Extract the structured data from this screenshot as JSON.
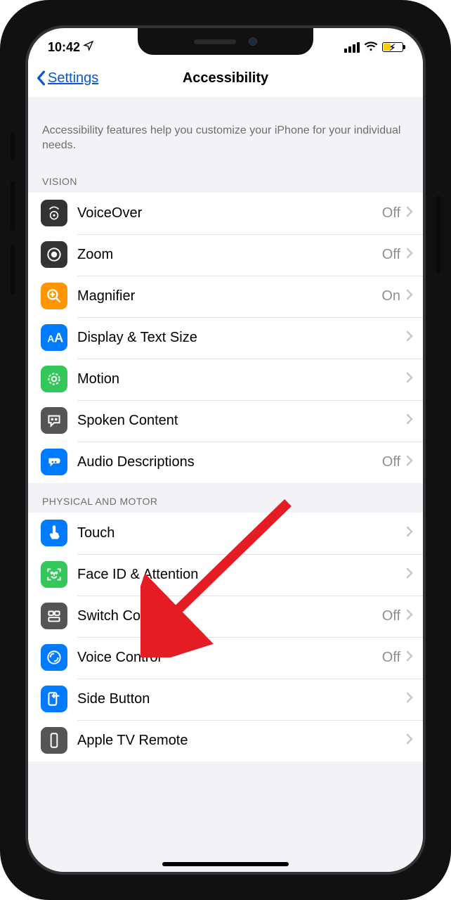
{
  "status": {
    "time": "10:42"
  },
  "nav": {
    "back": "Settings",
    "title": "Accessibility"
  },
  "intro": "Accessibility features help you customize your iPhone for your individual needs.",
  "sections": {
    "vision": {
      "header": "VISION",
      "voiceover": {
        "label": "VoiceOver",
        "value": "Off"
      },
      "zoom": {
        "label": "Zoom",
        "value": "Off"
      },
      "magnifier": {
        "label": "Magnifier",
        "value": "On"
      },
      "display": {
        "label": "Display & Text Size",
        "value": ""
      },
      "motion": {
        "label": "Motion",
        "value": ""
      },
      "spoken": {
        "label": "Spoken Content",
        "value": ""
      },
      "audiodesc": {
        "label": "Audio Descriptions",
        "value": "Off"
      }
    },
    "physical": {
      "header": "PHYSICAL AND MOTOR",
      "touch": {
        "label": "Touch",
        "value": ""
      },
      "faceid": {
        "label": "Face ID & Attention",
        "value": ""
      },
      "switch": {
        "label": "Switch Control",
        "value": "Off"
      },
      "voicectrl": {
        "label": "Voice Control",
        "value": "Off"
      },
      "sidebtn": {
        "label": "Side Button",
        "value": ""
      },
      "appletv": {
        "label": "Apple TV Remote",
        "value": ""
      }
    }
  }
}
